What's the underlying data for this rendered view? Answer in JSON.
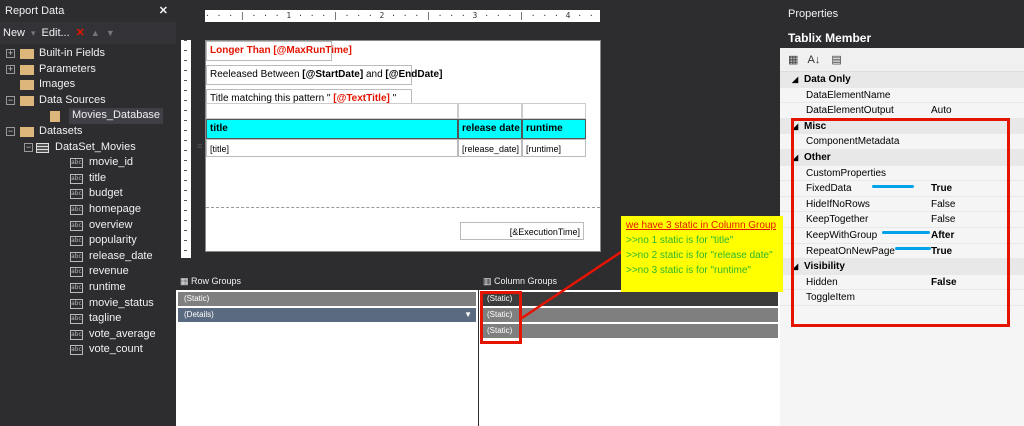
{
  "left_panel": {
    "title": "Report Data",
    "close_glyph": "✕",
    "toolbar": {
      "new_label": "New",
      "edit_label": "Edit...",
      "delete_glyph": "✕"
    },
    "tree": [
      {
        "label": "Built-in Fields",
        "expander": "⊞",
        "kind": "folder"
      },
      {
        "label": "Parameters",
        "expander": "⊞",
        "kind": "folder"
      },
      {
        "label": "Images",
        "expander": "",
        "kind": "folder"
      },
      {
        "label": "Data Sources",
        "expander": "⊟",
        "kind": "folder"
      },
      {
        "label": "Movies_Database",
        "expander": "",
        "kind": "datasource"
      },
      {
        "label": "Datasets",
        "expander": "⊟",
        "kind": "folder"
      },
      {
        "label": "DataSet_Movies",
        "expander": "⊟",
        "kind": "dataset"
      },
      {
        "label": "movie_id",
        "kind": "field"
      },
      {
        "label": "title",
        "kind": "field"
      },
      {
        "label": "budget",
        "kind": "field"
      },
      {
        "label": "homepage",
        "kind": "field"
      },
      {
        "label": "overview",
        "kind": "field"
      },
      {
        "label": "popularity",
        "kind": "field"
      },
      {
        "label": "release_date",
        "kind": "field"
      },
      {
        "label": "revenue",
        "kind": "field"
      },
      {
        "label": "runtime",
        "kind": "field"
      },
      {
        "label": "movie_status",
        "kind": "field"
      },
      {
        "label": "tagline",
        "kind": "field"
      },
      {
        "label": "vote_average",
        "kind": "field"
      },
      {
        "label": "vote_count",
        "kind": "field"
      }
    ],
    "field_icon_text": "abc"
  },
  "ruler_text": "· · · | · · · 1 · · · | · · · 2 · · · | · · · 3 · · · | · · · 4 · · · | · · · 5 · · · | · · · 6 ·",
  "report": {
    "longer_than": "Longer Than [@MaxRunTime]",
    "released_between_prefix": "Reeleased Between ",
    "start_date": "[@StartDate]",
    "and_text": " and ",
    "end_date": "[@EndDate]",
    "title_match_prefix": "Title matching this pattern \" ",
    "text_title": "[@TextTitle]",
    "title_match_suffix": " \"",
    "headers": [
      "title",
      "release date",
      "runtime"
    ],
    "row_marker": "≡",
    "cells": [
      "[title]",
      "[release_date]",
      "[runtime]"
    ],
    "execution_time": "[&ExecutionTime]"
  },
  "row_groups": {
    "header": "Row Groups",
    "items": [
      "(Static)",
      "(Details)"
    ]
  },
  "column_groups": {
    "header": "Column Groups",
    "items": [
      "(Static)",
      "(Static)",
      "(Static)"
    ]
  },
  "note": {
    "line1": "we have 3 static in Column Group",
    "line2": ">>no 1 static is for \"title\"",
    "line3": ">>no 2 static is for \"release date\"",
    "line4": ">>no 3 static is for \"runtime\""
  },
  "properties": {
    "title": "Properties",
    "subtitle": "Tablix Member",
    "rows": [
      {
        "type": "cat",
        "name": "Data Only",
        "caret": "◢"
      },
      {
        "type": "prop",
        "name": "DataElementName",
        "value": ""
      },
      {
        "type": "prop",
        "name": "DataElementOutput",
        "value": "Auto"
      },
      {
        "type": "cat",
        "name": "Misc",
        "caret": "◢"
      },
      {
        "type": "prop",
        "name": "ComponentMetadata",
        "value": ""
      },
      {
        "type": "cat",
        "name": "Other",
        "caret": "◢"
      },
      {
        "type": "prop",
        "name": "CustomProperties",
        "value": ""
      },
      {
        "type": "prop",
        "name": "FixedData",
        "value": "True",
        "bold": true
      },
      {
        "type": "prop",
        "name": "HideIfNoRows",
        "value": "False"
      },
      {
        "type": "prop",
        "name": "KeepTogether",
        "value": "False"
      },
      {
        "type": "prop",
        "name": "KeepWithGroup",
        "value": "After",
        "bold": true
      },
      {
        "type": "prop",
        "name": "RepeatOnNewPage",
        "value": "True",
        "bold": true
      },
      {
        "type": "cat",
        "name": "Visibility",
        "caret": "◢"
      },
      {
        "type": "prop",
        "name": "Hidden",
        "value": "False",
        "bold": true
      },
      {
        "type": "prop",
        "name": "ToggleItem",
        "value": ""
      }
    ]
  },
  "colors": {
    "accent_red": "#e51400",
    "highlight_cyan": "#00ffff",
    "note_yellow": "#ffff00",
    "note_green": "#2fb52f",
    "underline_blue": "#00a2e8"
  }
}
